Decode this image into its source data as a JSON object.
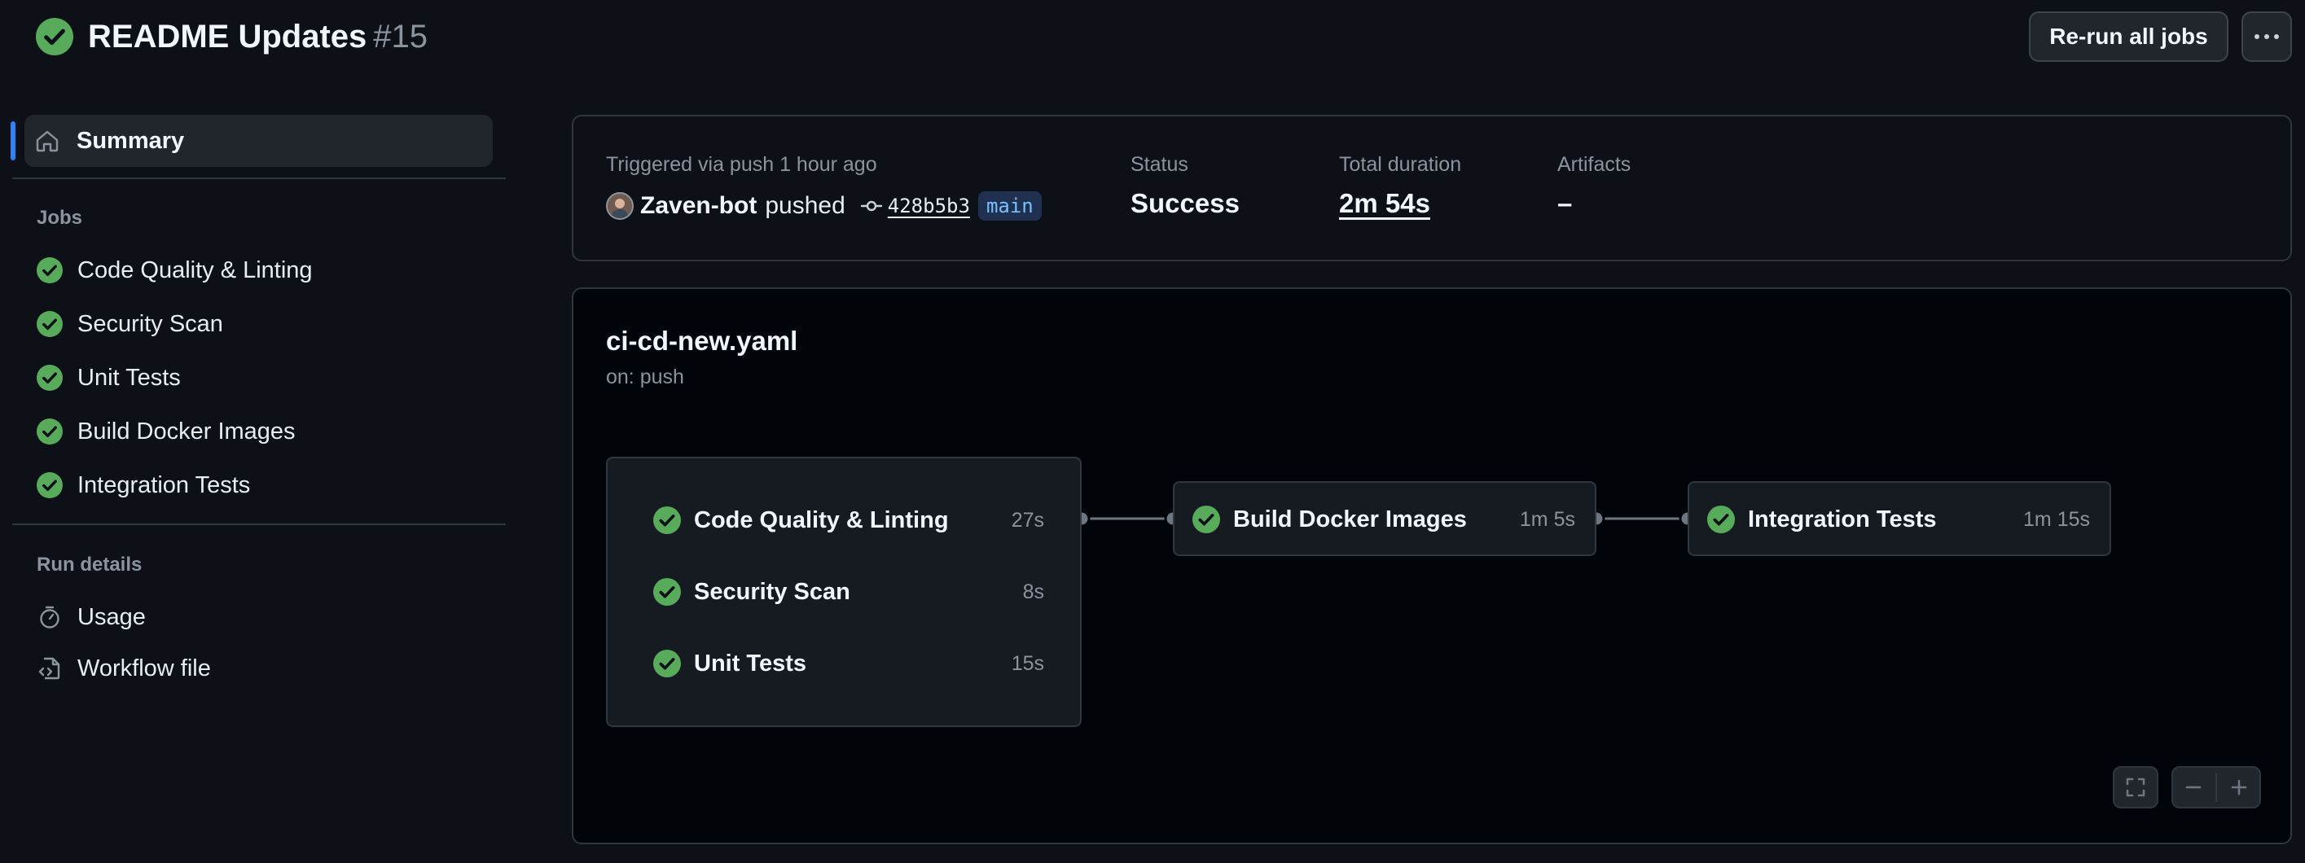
{
  "header": {
    "title": "README Updates",
    "run_number": "#15",
    "rerun_label": "Re-run all jobs",
    "status_icon": "check-circle-fill-icon"
  },
  "sidebar": {
    "summary_label": "Summary",
    "jobs_heading": "Jobs",
    "jobs": [
      {
        "label": "Code Quality & Linting",
        "status": "success"
      },
      {
        "label": "Security Scan",
        "status": "success"
      },
      {
        "label": "Unit Tests",
        "status": "success"
      },
      {
        "label": "Build Docker Images",
        "status": "success"
      },
      {
        "label": "Integration Tests",
        "status": "success"
      }
    ],
    "run_details_heading": "Run details",
    "run_details": [
      {
        "label": "Usage",
        "icon": "stopwatch-icon"
      },
      {
        "label": "Workflow file",
        "icon": "file-code-icon"
      }
    ]
  },
  "summary_card": {
    "triggered_label": "Triggered via push 1 hour ago",
    "actor": "Zaven-bot",
    "action": "pushed",
    "commit_sha": "428b5b3",
    "branch": "main",
    "status_label": "Status",
    "status_value": "Success",
    "duration_label": "Total duration",
    "duration_value": "2m 54s",
    "artifacts_label": "Artifacts",
    "artifacts_value": "–"
  },
  "workflow": {
    "filename": "ci-cd-new.yaml",
    "trigger": "on: push",
    "group_jobs": [
      {
        "name": "Code Quality & Linting",
        "duration": "27s"
      },
      {
        "name": "Security Scan",
        "duration": "8s"
      },
      {
        "name": "Unit Tests",
        "duration": "15s"
      }
    ],
    "build_job": {
      "name": "Build Docker Images",
      "duration": "1m 5s"
    },
    "integration_job": {
      "name": "Integration Tests",
      "duration": "1m 15s"
    }
  },
  "colors": {
    "background": "#0d1117",
    "success": "#3fb950",
    "accent": "#2f81f7",
    "border": "#30363d"
  }
}
